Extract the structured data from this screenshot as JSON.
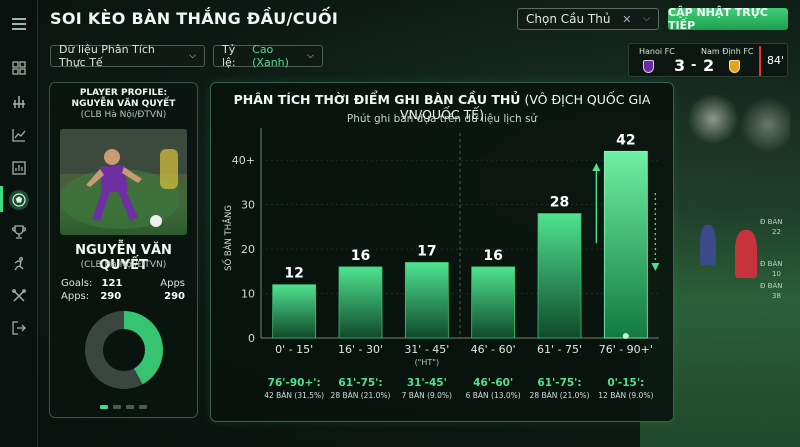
{
  "header": {
    "title": "SOI KÈO BÀN THẮNG ĐẦU/CUỐI",
    "player_select": "Chọn Cầu Thủ",
    "update_button": "CẬP NHẬT TRỰC TIẾP"
  },
  "filters": {
    "data_source": "Dữ liệu Phân Tích Thực Tế",
    "rate_label": "Tỷ lệ:",
    "rate_value": "Cao (Xanh)"
  },
  "scoreboard": {
    "home_team": "Hanoi FC",
    "away_team": "Nam Định FC",
    "home_score": "3",
    "separator": "-",
    "away_score": "2",
    "minute": "84'"
  },
  "profile": {
    "heading": "PLAYER PROFILE:",
    "name_small": "NGUYỄN VĂN QUYẾT",
    "club_small": "(CLB Hà Nội/ĐTVN)",
    "name": "NGUYỄN VĂN QUYẾT",
    "club": "(CLB Hà Nội/ĐTVN)",
    "goals_label": "Goals:",
    "goals": "121",
    "apps_label": "Apps:",
    "apps": "290",
    "apps_right_label": "Apps",
    "apps_right": "290",
    "donut_share": 0.42
  },
  "sidebar": {
    "items": [
      "grid-icon",
      "signal-icon",
      "line-chart-icon",
      "bar-chart-icon",
      "football-icon",
      "trophy-icon",
      "runner-icon",
      "tools-icon",
      "logout-icon"
    ]
  },
  "colors": {
    "accent": "#3ddc84",
    "panel_border": "#3f5f4d",
    "background": "#0d1a14"
  },
  "chart_data": {
    "type": "bar",
    "title_bold": "PHÂN TÍCH THỜI ĐIỂM GHI BÀN CẦU THỦ",
    "title_rest": " (VÔ ĐỊCH QUỐC GIA VN/QUỐC TẾ)",
    "subtitle": "Phút ghi bàn dựa trên dữ liệu lịch sử",
    "ylabel": "SỐ BÀN THẮNG",
    "ylim": [
      0,
      45
    ],
    "yticks": [
      "0",
      "10",
      "20",
      "30",
      "40+"
    ],
    "ytick_values": [
      0,
      10,
      20,
      30,
      40
    ],
    "categories": [
      "0' - 15'",
      "16' - 30'",
      "31' - 45'",
      "46' - 60'",
      "61' - 75'",
      "76' - 90+'"
    ],
    "category_notes": [
      "",
      "",
      "(\"HT\")",
      "",
      "",
      ""
    ],
    "values": [
      12,
      16,
      17,
      16,
      28,
      42
    ],
    "footnotes": [
      {
        "title": "76'-90+':",
        "detail": "42 BÀN (31.5%)"
      },
      {
        "title": "61'-75':",
        "detail": "28 BÀN (21.0%)"
      },
      {
        "title": "31'-45'",
        "detail": "7 BÀN (9.0%)"
      },
      {
        "title": "46'-60'",
        "detail": "6 BÀN (13.0%)"
      },
      {
        "title": "61'-75':",
        "detail": "28 BÀN (21.0%)"
      },
      {
        "title": "0'-15':",
        "detail": "12 BÀN (9.0%)"
      }
    ]
  },
  "background_stats": [
    "Đ BÀN",
    "22",
    "Đ BÀN",
    "10",
    "Đ BÀN",
    "38"
  ]
}
